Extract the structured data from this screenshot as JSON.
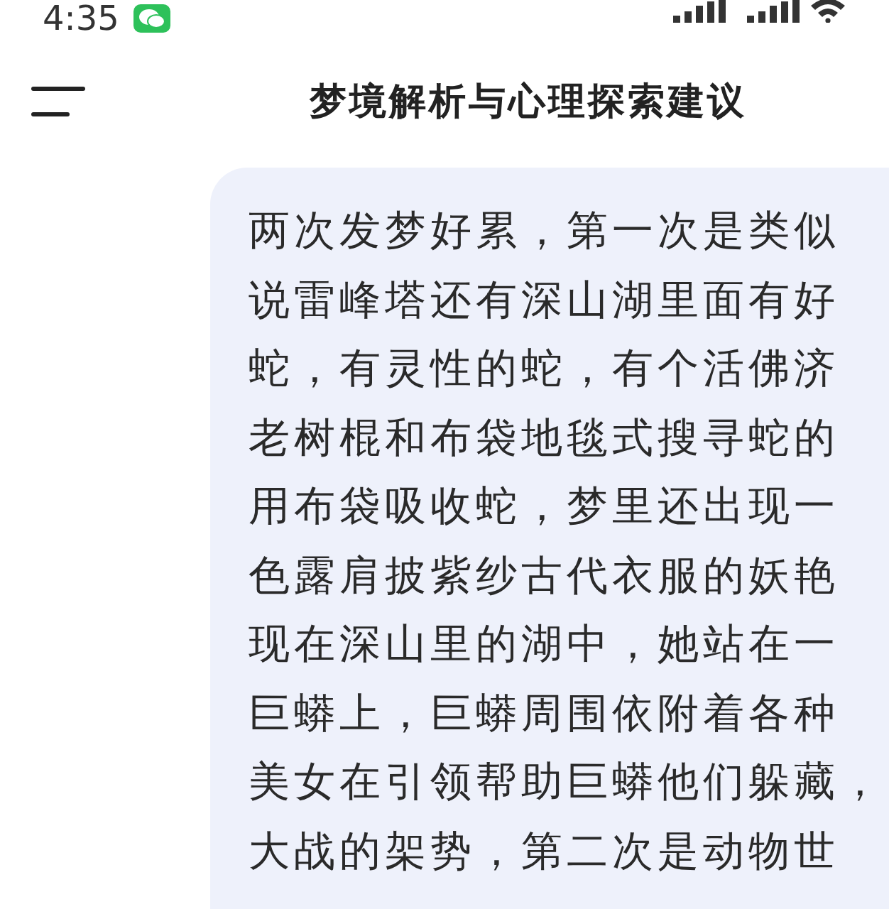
{
  "status_bar": {
    "time": "4:35"
  },
  "header": {
    "title": "梦境解析与心理探索建议"
  },
  "message": {
    "lines": [
      "两次发梦好累，第一次是类似",
      "说雷峰塔还有深山湖里面有好",
      "蛇，有灵性的蛇，有个活佛济",
      "老树棍和布袋地毯式搜寻蛇的",
      "用布袋吸收蛇，梦里还出现一",
      "色露肩披紫纱古代衣服的妖艳",
      "现在深山里的湖中，她站在一",
      "巨蟒上，巨蟒周围依附着各种",
      "美女在引领帮助巨蟒他们躲藏，",
      "大战的架势，第二次是动物世"
    ]
  }
}
